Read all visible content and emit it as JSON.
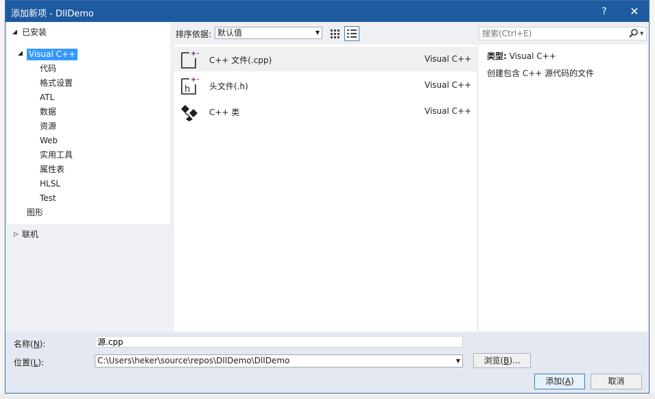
{
  "dialog": {
    "title": "添加新项 - DllDemo",
    "help_label": "?",
    "close_label": "✕"
  },
  "tree": {
    "installed": "已安装",
    "visual_cpp": "Visual C++",
    "children": [
      "代码",
      "格式设置",
      "ATL",
      "数据",
      "资源",
      "Web",
      "实用工具",
      "属性表",
      "HLSL",
      "Test"
    ],
    "graphics": "图形",
    "online": "联机"
  },
  "toolbar": {
    "sort_label": "排序依据:",
    "sort_value": "默认值",
    "search_placeholder": "搜索(Ctrl+E)"
  },
  "templates": [
    {
      "name": "C++ 文件(.cpp)",
      "lang": "Visual C++",
      "icon": "cpp-file-icon"
    },
    {
      "name": "头文件(.h)",
      "lang": "Visual C++",
      "icon": "header-file-icon"
    },
    {
      "name": "C++ 类",
      "lang": "Visual C++",
      "icon": "cpp-class-icon"
    }
  ],
  "details": {
    "type_label": "类型:",
    "type_value": "Visual C++",
    "description": "创建包含 C++ 源代码的文件"
  },
  "form": {
    "name_label_prefix": "名称(",
    "name_label_key": "N",
    "name_label_suffix": "):",
    "name_value": "源.cpp",
    "location_label_prefix": "位置(",
    "location_label_key": "L",
    "location_label_suffix": "):",
    "location_value": "C:\\Users\\heker\\source\\repos\\DllDemo\\DllDemo",
    "browse_prefix": "浏览(",
    "browse_key": "B",
    "browse_suffix": ")...",
    "add_prefix": "添加(",
    "add_key": "A",
    "add_suffix": ")",
    "cancel_label": "取消"
  },
  "colors": {
    "titlebar": "#1e5aa0",
    "selection": "#3399ff",
    "accent_border": "#3c7fb1"
  }
}
